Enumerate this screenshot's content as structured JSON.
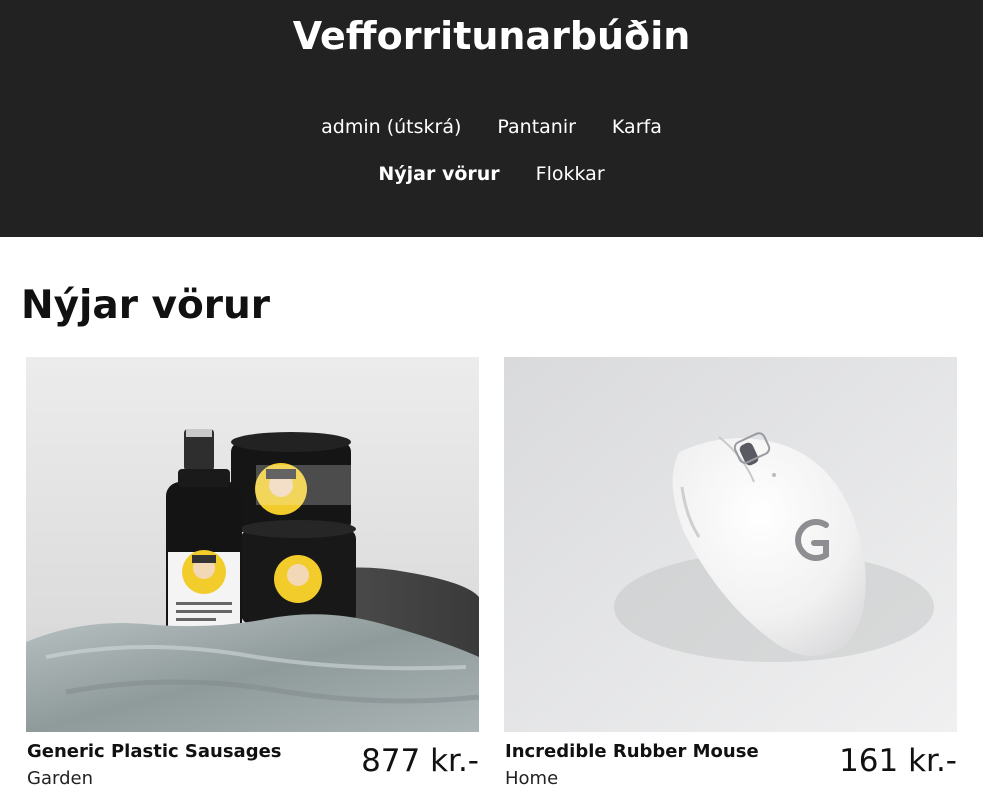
{
  "site": {
    "title": "Vefforritunarbúðin"
  },
  "nav": {
    "admin": "admin (útskrá)",
    "orders": "Pantanir",
    "cart": "Karfa",
    "new_products": "Nýjar vörur",
    "categories": "Flokkar",
    "active": "new_products"
  },
  "main": {
    "heading": "Nýjar vörur",
    "products": [
      {
        "name": "Generic Plastic Sausages",
        "category": "Garden",
        "price": "877 kr.-",
        "image": "skincare-products-on-towel"
      },
      {
        "name": "Incredible Rubber Mouse",
        "category": "Home",
        "price": "161 kr.-",
        "image": "white-wireless-mouse"
      }
    ]
  },
  "colors": {
    "header_bg": "#222222",
    "header_text": "#ffffff",
    "page_bg": "#ffffff"
  }
}
